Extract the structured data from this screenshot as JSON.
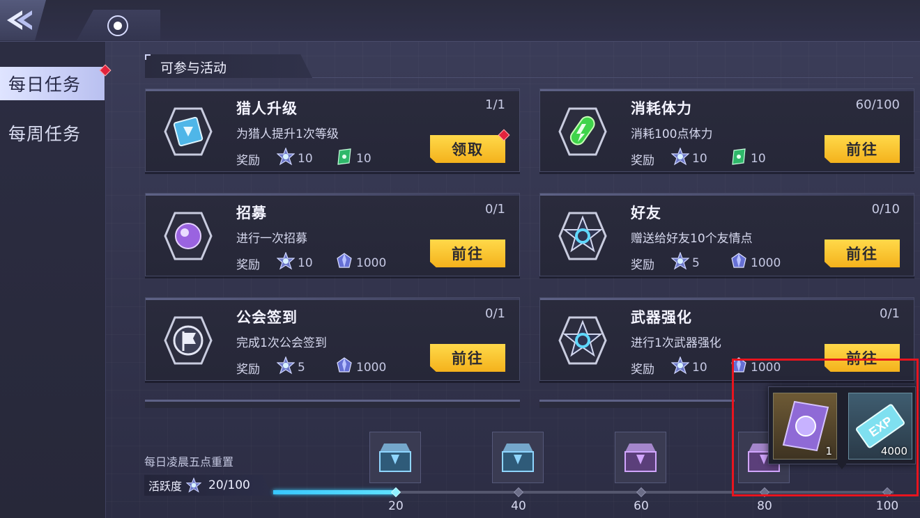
{
  "sidebar": {
    "tabs": [
      {
        "label": "每日任务",
        "active": true
      },
      {
        "label": "每周任务",
        "active": false
      }
    ]
  },
  "section": {
    "title": "可参与活动"
  },
  "reward_label": "奖励",
  "tasks": [
    {
      "title": "猎人升级",
      "progress": "1/1",
      "desc": "为猎人提升1次等级",
      "rewards": [
        {
          "icon": "star-badge-icon",
          "value": "10"
        },
        {
          "icon": "green-book-icon",
          "value": "10"
        }
      ],
      "button": "领取",
      "notify": true
    },
    {
      "title": "消耗体力",
      "progress": "60/100",
      "desc": "消耗100点体力",
      "rewards": [
        {
          "icon": "star-badge-icon",
          "value": "10"
        },
        {
          "icon": "green-book-icon",
          "value": "10"
        }
      ],
      "button": "前往",
      "notify": false
    },
    {
      "title": "招募",
      "progress": "0/1",
      "desc": "进行一次招募",
      "rewards": [
        {
          "icon": "star-badge-icon",
          "value": "10"
        },
        {
          "icon": "crystal-icon",
          "value": "1000"
        }
      ],
      "button": "前往",
      "notify": false
    },
    {
      "title": "好友",
      "progress": "0/10",
      "desc": "赠送给好友10个友情点",
      "rewards": [
        {
          "icon": "star-badge-icon",
          "value": "5"
        },
        {
          "icon": "crystal-icon",
          "value": "1000"
        }
      ],
      "button": "前往",
      "notify": false
    },
    {
      "title": "公会签到",
      "progress": "0/1",
      "desc": "完成1次公会签到",
      "rewards": [
        {
          "icon": "star-badge-icon",
          "value": "5"
        },
        {
          "icon": "crystal-icon",
          "value": "1000"
        }
      ],
      "button": "前往",
      "notify": false
    },
    {
      "title": "武器强化",
      "progress": "0/1",
      "desc": "进行1次武器强化",
      "rewards": [
        {
          "icon": "star-badge-icon",
          "value": "10"
        },
        {
          "icon": "crystal-icon",
          "value": "1000"
        }
      ],
      "button": "前往",
      "notify": false
    }
  ],
  "activity": {
    "reset_text": "每日凌晨五点重置",
    "label": "活跃度",
    "value": "20/100",
    "progress_fraction": 0.2,
    "milestones": [
      "20",
      "40",
      "60",
      "80",
      "100"
    ]
  },
  "popup": {
    "items": [
      {
        "icon": "purple-card-icon",
        "count": "1"
      },
      {
        "icon": "exp-card-icon",
        "count": "4000"
      }
    ]
  },
  "colors": {
    "accent": "#f6bf2a",
    "highlight": "#e8141e",
    "progress": "#38c7ff",
    "notify": "#e3233d"
  }
}
